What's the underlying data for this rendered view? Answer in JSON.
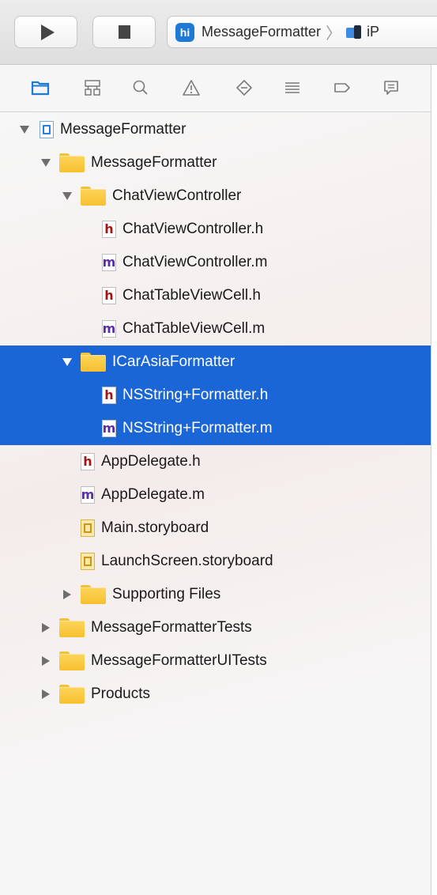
{
  "toolbar": {
    "scheme_icon_text": "hi",
    "scheme_name": "MessageFormatter",
    "scheme_separator": "〉",
    "device_name": "iP"
  },
  "navigator_tabs": [
    {
      "name": "project-navigator",
      "icon": "folder-icon",
      "active": true
    },
    {
      "name": "symbol-navigator",
      "icon": "hierarchy-icon",
      "active": false
    },
    {
      "name": "find-navigator",
      "icon": "search-icon",
      "active": false
    },
    {
      "name": "issue-navigator",
      "icon": "warning-icon",
      "active": false
    },
    {
      "name": "test-navigator",
      "icon": "diamond-icon",
      "active": false
    },
    {
      "name": "debug-navigator",
      "icon": "list-icon",
      "active": false
    },
    {
      "name": "breakpoint-navigator",
      "icon": "tag-icon",
      "active": false
    },
    {
      "name": "report-navigator",
      "icon": "message-icon",
      "active": false
    }
  ],
  "tree": [
    {
      "label": "MessageFormatter",
      "kind": "project",
      "depth": 0,
      "disclosure": "open",
      "selected": false
    },
    {
      "label": "MessageFormatter",
      "kind": "folder",
      "depth": 1,
      "disclosure": "open",
      "selected": false
    },
    {
      "label": "ChatViewController",
      "kind": "folder",
      "depth": 2,
      "disclosure": "open",
      "selected": false
    },
    {
      "label": "ChatViewController.h",
      "kind": "h",
      "depth": 3,
      "disclosure": "none",
      "selected": false
    },
    {
      "label": "ChatViewController.m",
      "kind": "m",
      "depth": 3,
      "disclosure": "none",
      "selected": false
    },
    {
      "label": "ChatTableViewCell.h",
      "kind": "h",
      "depth": 3,
      "disclosure": "none",
      "selected": false
    },
    {
      "label": "ChatTableViewCell.m",
      "kind": "m",
      "depth": 3,
      "disclosure": "none",
      "selected": false
    },
    {
      "label": "ICarAsiaFormatter",
      "kind": "folder",
      "depth": 2,
      "disclosure": "open",
      "selected": true
    },
    {
      "label": "NSString+Formatter.h",
      "kind": "h",
      "depth": 3,
      "disclosure": "none",
      "selected": true
    },
    {
      "label": "NSString+Formatter.m",
      "kind": "m",
      "depth": 3,
      "disclosure": "none",
      "selected": true
    },
    {
      "label": "AppDelegate.h",
      "kind": "h",
      "depth": 2,
      "disclosure": "none",
      "selected": false
    },
    {
      "label": "AppDelegate.m",
      "kind": "m",
      "depth": 2,
      "disclosure": "none",
      "selected": false
    },
    {
      "label": "Main.storyboard",
      "kind": "storyboard",
      "depth": 2,
      "disclosure": "none",
      "selected": false
    },
    {
      "label": "LaunchScreen.storyboard",
      "kind": "storyboard",
      "depth": 2,
      "disclosure": "none",
      "selected": false
    },
    {
      "label": "Supporting Files",
      "kind": "folder",
      "depth": 2,
      "disclosure": "closed",
      "selected": false
    },
    {
      "label": "MessageFormatterTests",
      "kind": "folder",
      "depth": 1,
      "disclosure": "closed",
      "selected": false
    },
    {
      "label": "MessageFormatterUITests",
      "kind": "folder",
      "depth": 1,
      "disclosure": "closed",
      "selected": false
    },
    {
      "label": "Products",
      "kind": "folder",
      "depth": 1,
      "disclosure": "closed",
      "selected": false
    }
  ],
  "file_letters": {
    "h": "h",
    "m": "m"
  },
  "colors": {
    "selection": "#1a66d6",
    "active_tab": "#1f7ad6",
    "inactive_tab": "#7a7a7a",
    "folder": "#f7c02e",
    "h_file": "#a31515",
    "m_file": "#5a2ea6"
  }
}
